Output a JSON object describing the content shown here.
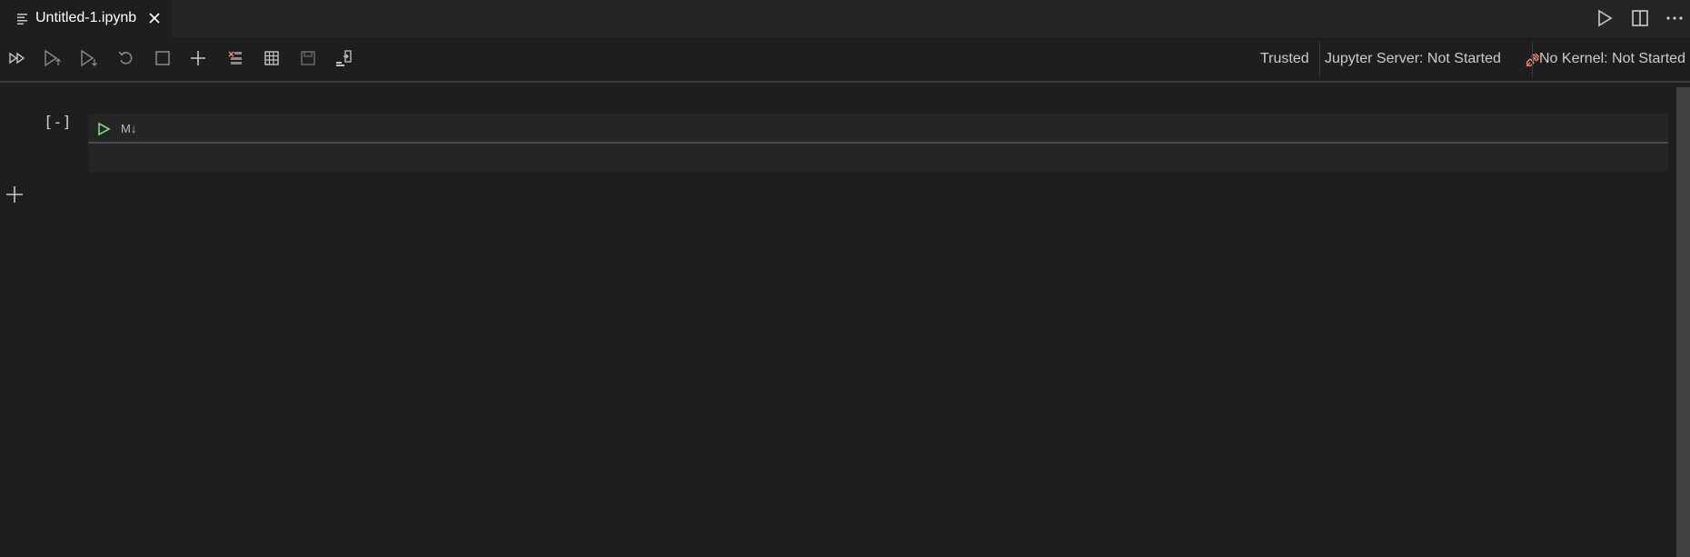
{
  "tab": {
    "title": "Untitled-1.ipynb",
    "icons": {
      "file": "notebook-file-icon",
      "close": "close-icon"
    }
  },
  "tab_actions": [
    "run-icon",
    "split-editor-icon",
    "more-actions-icon"
  ],
  "toolbar": {
    "buttons": [
      "run-all-icon",
      "run-above-icon",
      "run-below-icon",
      "restart-kernel-icon",
      "interrupt-kernel-icon",
      "add-cell-icon",
      "clear-outputs-icon",
      "variables-icon",
      "save-icon",
      "export-icon"
    ],
    "trusted_label": "Trusted",
    "server_label": "Jupyter Server: Not Started",
    "kernel_label": "No Kernel: Not Started",
    "server_icon": "plug-disconnected-icon"
  },
  "cell": {
    "prompt": "[-]",
    "type_label": "M↓",
    "content": ""
  },
  "colors": {
    "background": "#1e1e1e",
    "tabbar": "#252526",
    "run_green": "#89d185",
    "disconnected_red": "#f48771"
  }
}
